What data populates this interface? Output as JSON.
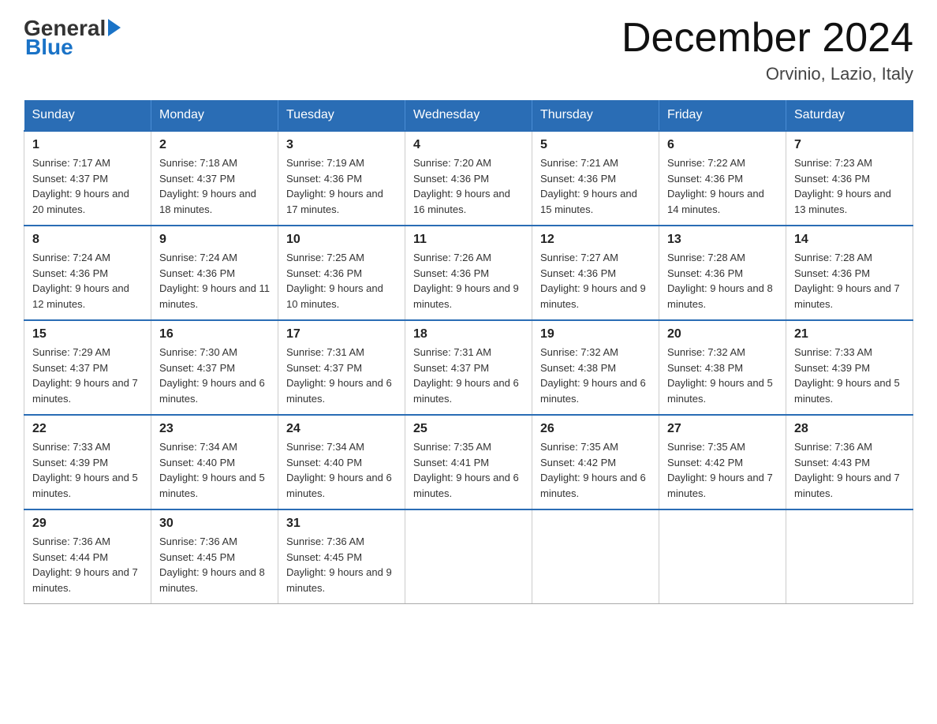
{
  "header": {
    "logo": {
      "general": "General",
      "arrow_symbol": "▶",
      "blue": "Blue"
    },
    "title": "December 2024",
    "location": "Orvinio, Lazio, Italy"
  },
  "days_of_week": [
    "Sunday",
    "Monday",
    "Tuesday",
    "Wednesday",
    "Thursday",
    "Friday",
    "Saturday"
  ],
  "weeks": [
    [
      {
        "day": "1",
        "sunrise": "Sunrise: 7:17 AM",
        "sunset": "Sunset: 4:37 PM",
        "daylight": "Daylight: 9 hours and 20 minutes."
      },
      {
        "day": "2",
        "sunrise": "Sunrise: 7:18 AM",
        "sunset": "Sunset: 4:37 PM",
        "daylight": "Daylight: 9 hours and 18 minutes."
      },
      {
        "day": "3",
        "sunrise": "Sunrise: 7:19 AM",
        "sunset": "Sunset: 4:36 PM",
        "daylight": "Daylight: 9 hours and 17 minutes."
      },
      {
        "day": "4",
        "sunrise": "Sunrise: 7:20 AM",
        "sunset": "Sunset: 4:36 PM",
        "daylight": "Daylight: 9 hours and 16 minutes."
      },
      {
        "day": "5",
        "sunrise": "Sunrise: 7:21 AM",
        "sunset": "Sunset: 4:36 PM",
        "daylight": "Daylight: 9 hours and 15 minutes."
      },
      {
        "day": "6",
        "sunrise": "Sunrise: 7:22 AM",
        "sunset": "Sunset: 4:36 PM",
        "daylight": "Daylight: 9 hours and 14 minutes."
      },
      {
        "day": "7",
        "sunrise": "Sunrise: 7:23 AM",
        "sunset": "Sunset: 4:36 PM",
        "daylight": "Daylight: 9 hours and 13 minutes."
      }
    ],
    [
      {
        "day": "8",
        "sunrise": "Sunrise: 7:24 AM",
        "sunset": "Sunset: 4:36 PM",
        "daylight": "Daylight: 9 hours and 12 minutes."
      },
      {
        "day": "9",
        "sunrise": "Sunrise: 7:24 AM",
        "sunset": "Sunset: 4:36 PM",
        "daylight": "Daylight: 9 hours and 11 minutes."
      },
      {
        "day": "10",
        "sunrise": "Sunrise: 7:25 AM",
        "sunset": "Sunset: 4:36 PM",
        "daylight": "Daylight: 9 hours and 10 minutes."
      },
      {
        "day": "11",
        "sunrise": "Sunrise: 7:26 AM",
        "sunset": "Sunset: 4:36 PM",
        "daylight": "Daylight: 9 hours and 9 minutes."
      },
      {
        "day": "12",
        "sunrise": "Sunrise: 7:27 AM",
        "sunset": "Sunset: 4:36 PM",
        "daylight": "Daylight: 9 hours and 9 minutes."
      },
      {
        "day": "13",
        "sunrise": "Sunrise: 7:28 AM",
        "sunset": "Sunset: 4:36 PM",
        "daylight": "Daylight: 9 hours and 8 minutes."
      },
      {
        "day": "14",
        "sunrise": "Sunrise: 7:28 AM",
        "sunset": "Sunset: 4:36 PM",
        "daylight": "Daylight: 9 hours and 7 minutes."
      }
    ],
    [
      {
        "day": "15",
        "sunrise": "Sunrise: 7:29 AM",
        "sunset": "Sunset: 4:37 PM",
        "daylight": "Daylight: 9 hours and 7 minutes."
      },
      {
        "day": "16",
        "sunrise": "Sunrise: 7:30 AM",
        "sunset": "Sunset: 4:37 PM",
        "daylight": "Daylight: 9 hours and 6 minutes."
      },
      {
        "day": "17",
        "sunrise": "Sunrise: 7:31 AM",
        "sunset": "Sunset: 4:37 PM",
        "daylight": "Daylight: 9 hours and 6 minutes."
      },
      {
        "day": "18",
        "sunrise": "Sunrise: 7:31 AM",
        "sunset": "Sunset: 4:37 PM",
        "daylight": "Daylight: 9 hours and 6 minutes."
      },
      {
        "day": "19",
        "sunrise": "Sunrise: 7:32 AM",
        "sunset": "Sunset: 4:38 PM",
        "daylight": "Daylight: 9 hours and 6 minutes."
      },
      {
        "day": "20",
        "sunrise": "Sunrise: 7:32 AM",
        "sunset": "Sunset: 4:38 PM",
        "daylight": "Daylight: 9 hours and 5 minutes."
      },
      {
        "day": "21",
        "sunrise": "Sunrise: 7:33 AM",
        "sunset": "Sunset: 4:39 PM",
        "daylight": "Daylight: 9 hours and 5 minutes."
      }
    ],
    [
      {
        "day": "22",
        "sunrise": "Sunrise: 7:33 AM",
        "sunset": "Sunset: 4:39 PM",
        "daylight": "Daylight: 9 hours and 5 minutes."
      },
      {
        "day": "23",
        "sunrise": "Sunrise: 7:34 AM",
        "sunset": "Sunset: 4:40 PM",
        "daylight": "Daylight: 9 hours and 5 minutes."
      },
      {
        "day": "24",
        "sunrise": "Sunrise: 7:34 AM",
        "sunset": "Sunset: 4:40 PM",
        "daylight": "Daylight: 9 hours and 6 minutes."
      },
      {
        "day": "25",
        "sunrise": "Sunrise: 7:35 AM",
        "sunset": "Sunset: 4:41 PM",
        "daylight": "Daylight: 9 hours and 6 minutes."
      },
      {
        "day": "26",
        "sunrise": "Sunrise: 7:35 AM",
        "sunset": "Sunset: 4:42 PM",
        "daylight": "Daylight: 9 hours and 6 minutes."
      },
      {
        "day": "27",
        "sunrise": "Sunrise: 7:35 AM",
        "sunset": "Sunset: 4:42 PM",
        "daylight": "Daylight: 9 hours and 7 minutes."
      },
      {
        "day": "28",
        "sunrise": "Sunrise: 7:36 AM",
        "sunset": "Sunset: 4:43 PM",
        "daylight": "Daylight: 9 hours and 7 minutes."
      }
    ],
    [
      {
        "day": "29",
        "sunrise": "Sunrise: 7:36 AM",
        "sunset": "Sunset: 4:44 PM",
        "daylight": "Daylight: 9 hours and 7 minutes."
      },
      {
        "day": "30",
        "sunrise": "Sunrise: 7:36 AM",
        "sunset": "Sunset: 4:45 PM",
        "daylight": "Daylight: 9 hours and 8 minutes."
      },
      {
        "day": "31",
        "sunrise": "Sunrise: 7:36 AM",
        "sunset": "Sunset: 4:45 PM",
        "daylight": "Daylight: 9 hours and 9 minutes."
      },
      null,
      null,
      null,
      null
    ]
  ]
}
